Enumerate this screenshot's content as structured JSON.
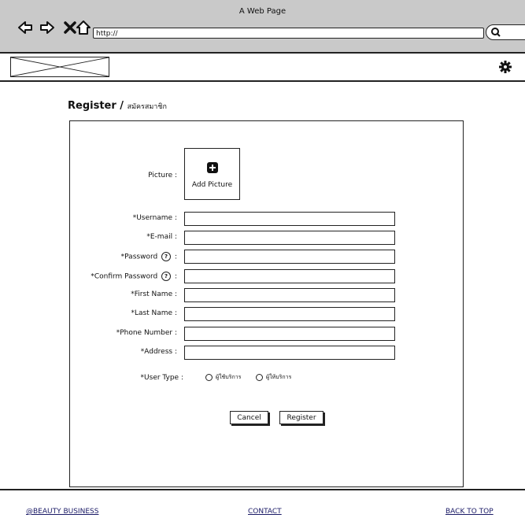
{
  "browser": {
    "window_title": "A Web Page",
    "url": "http://"
  },
  "page": {
    "title": "Register /",
    "title_thai": "สมัครสมาชิก"
  },
  "form": {
    "picture_label": "Picture :",
    "add_picture": "Add Picture",
    "fields": {
      "username": "*Username :",
      "email": "*E-mail :",
      "password": "*Password",
      "confirm_password": "*Confirm Password",
      "first_name": "*First Name :",
      "last_name": "*Last Name :",
      "phone": "*Phone Number :",
      "address": "*Address :"
    },
    "help_symbol": "?",
    "colon": ":",
    "user_type_label": "*User Type :",
    "user_type_options": [
      "ผู้ใช้บริการ",
      "ผู้ให้บริการ"
    ],
    "cancel": "Cancel",
    "register": "Register"
  },
  "footer": {
    "brand": "@BEAUTY BUSINESS",
    "contact": "CONTACT",
    "back_to_top": "BACK TO TOP"
  },
  "colors": {
    "chrome": "#c9c9c9",
    "outline": "#222222",
    "link": "#1a1a66"
  }
}
